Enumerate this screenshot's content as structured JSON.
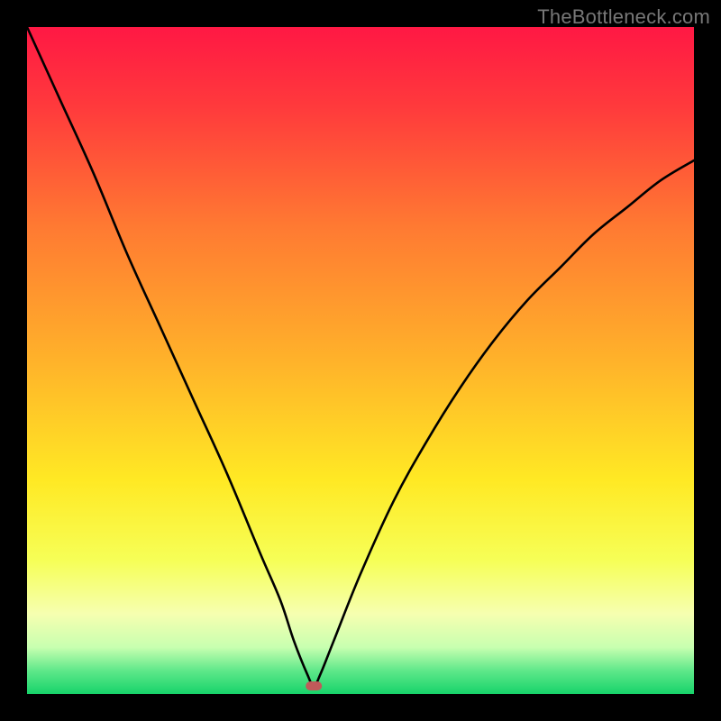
{
  "watermark": "TheBottleneck.com",
  "chart_data": {
    "type": "line",
    "title": "",
    "xlabel": "",
    "ylabel": "",
    "xlim": [
      0,
      100
    ],
    "ylim": [
      0,
      100
    ],
    "grid": false,
    "legend": false,
    "notes": "V-shaped bottleneck curve. X axis: component strength (0–100, unlabeled). Y axis: bottleneck % (0–100, unlabeled). Background is a vertical rainbow gradient from red (top ≈100%) through orange, yellow to green (bottom ≈0%). The black curve drops from near 100% at x≈0 to ~0% at the optimum x≈43, then rises again toward ~80% at x=100. A small red marker sits at the curve minimum.",
    "gradient_stops": [
      {
        "offset": 0.0,
        "color": "#ff1844"
      },
      {
        "offset": 0.12,
        "color": "#ff3a3c"
      },
      {
        "offset": 0.3,
        "color": "#ff7a32"
      },
      {
        "offset": 0.5,
        "color": "#ffb22a"
      },
      {
        "offset": 0.68,
        "color": "#ffe924"
      },
      {
        "offset": 0.8,
        "color": "#f6ff57"
      },
      {
        "offset": 0.88,
        "color": "#f6ffb0"
      },
      {
        "offset": 0.93,
        "color": "#c8ffb0"
      },
      {
        "offset": 0.965,
        "color": "#5fe88a"
      },
      {
        "offset": 1.0,
        "color": "#17d36a"
      }
    ],
    "marker": {
      "x": 43,
      "y": 1.2,
      "color": "#c05a5a"
    },
    "series": [
      {
        "name": "bottleneck-curve",
        "x": [
          0,
          5,
          10,
          15,
          20,
          25,
          30,
          35,
          38,
          40,
          42,
          43,
          44,
          46,
          50,
          55,
          60,
          65,
          70,
          75,
          80,
          85,
          90,
          95,
          100
        ],
        "y": [
          100,
          89,
          78,
          66,
          55,
          44,
          33,
          21,
          14,
          8,
          3,
          1.2,
          3,
          8,
          18,
          29,
          38,
          46,
          53,
          59,
          64,
          69,
          73,
          77,
          80
        ]
      }
    ]
  }
}
